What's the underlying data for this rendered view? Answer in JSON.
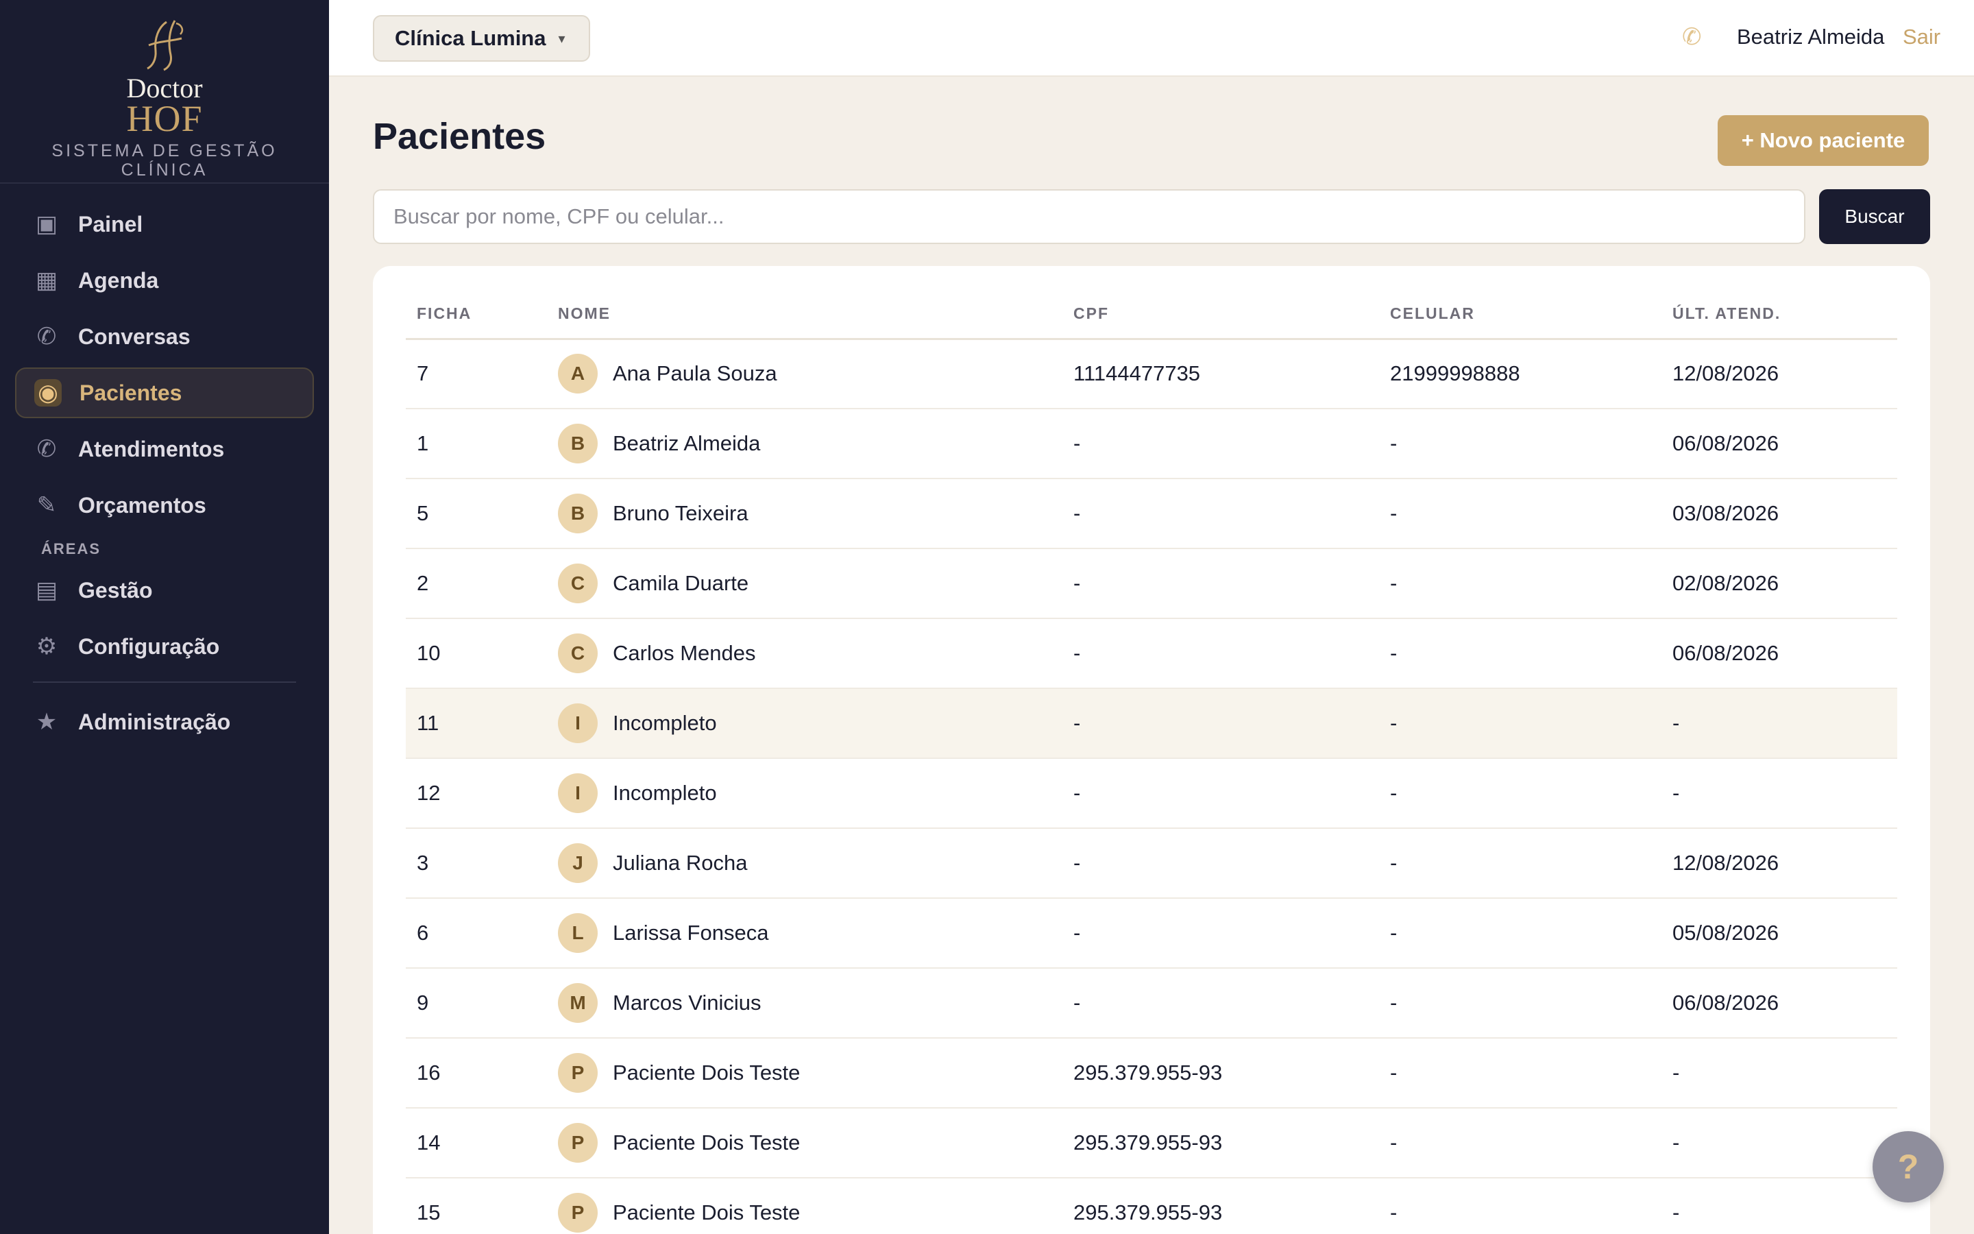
{
  "brand": {
    "line1": "Doctor",
    "line2": "HOF",
    "subtitle": "SISTEMA DE GESTÃO CLÍNICA",
    "accent_color": "#c8a46a"
  },
  "sidebar": {
    "items": [
      {
        "label": "Painel",
        "icon": "dashboard-icon",
        "glyph": "▣"
      },
      {
        "label": "Agenda",
        "icon": "calendar-icon",
        "glyph": "▦"
      },
      {
        "label": "Conversas",
        "icon": "whatsapp-icon",
        "glyph": "✆"
      },
      {
        "label": "Pacientes",
        "icon": "patients-icon",
        "glyph": "◉",
        "active": true
      },
      {
        "label": "Atendimentos",
        "icon": "whatsapp-icon",
        "glyph": "✆"
      },
      {
        "label": "Orçamentos",
        "icon": "pencil-icon",
        "glyph": "✎"
      }
    ],
    "section_label": "ÁREAS",
    "area_items": [
      {
        "label": "Gestão",
        "icon": "list-icon",
        "glyph": "▤"
      },
      {
        "label": "Configuração",
        "icon": "gear-icon",
        "glyph": "⚙"
      }
    ],
    "admin_item": {
      "label": "Administração",
      "icon": "star-icon",
      "glyph": "★"
    }
  },
  "topbar": {
    "clinic": "Clínica Lumina",
    "caret": "▾",
    "phone_glyph": "✆",
    "user": "Beatriz Almeida",
    "logout": "Sair"
  },
  "main": {
    "title": "Pacientes",
    "new_button": "+ Novo paciente",
    "search_placeholder": "Buscar por nome, CPF ou celular...",
    "search_value": "",
    "search_button": "Buscar"
  },
  "table": {
    "columns": [
      "FICHA",
      "NOME",
      "CPF",
      "CELULAR",
      "ÚLT. ATEND."
    ],
    "rows": [
      {
        "ficha": "7",
        "initial": "A",
        "nome": "Ana Paula Souza",
        "cpf": "11144477735",
        "celular": "21999998888",
        "ult": "12/08/2026"
      },
      {
        "ficha": "1",
        "initial": "B",
        "nome": "Beatriz Almeida",
        "cpf": "-",
        "celular": "-",
        "ult": "06/08/2026"
      },
      {
        "ficha": "5",
        "initial": "B",
        "nome": "Bruno Teixeira",
        "cpf": "-",
        "celular": "-",
        "ult": "03/08/2026"
      },
      {
        "ficha": "2",
        "initial": "C",
        "nome": "Camila Duarte",
        "cpf": "-",
        "celular": "-",
        "ult": "02/08/2026"
      },
      {
        "ficha": "10",
        "initial": "C",
        "nome": "Carlos Mendes",
        "cpf": "-",
        "celular": "-",
        "ult": "06/08/2026"
      },
      {
        "ficha": "11",
        "initial": "I",
        "nome": "Incompleto",
        "cpf": "-",
        "celular": "-",
        "ult": "-",
        "highlight": true
      },
      {
        "ficha": "12",
        "initial": "I",
        "nome": "Incompleto",
        "cpf": "-",
        "celular": "-",
        "ult": "-"
      },
      {
        "ficha": "3",
        "initial": "J",
        "nome": "Juliana Rocha",
        "cpf": "-",
        "celular": "-",
        "ult": "12/08/2026"
      },
      {
        "ficha": "6",
        "initial": "L",
        "nome": "Larissa Fonseca",
        "cpf": "-",
        "celular": "-",
        "ult": "05/08/2026"
      },
      {
        "ficha": "9",
        "initial": "M",
        "nome": "Marcos Vinicius",
        "cpf": "-",
        "celular": "-",
        "ult": "06/08/2026"
      },
      {
        "ficha": "16",
        "initial": "P",
        "nome": "Paciente Dois Teste",
        "cpf": "295.379.955-93",
        "celular": "-",
        "ult": "-"
      },
      {
        "ficha": "14",
        "initial": "P",
        "nome": "Paciente Dois Teste",
        "cpf": "295.379.955-93",
        "celular": "-",
        "ult": "-"
      },
      {
        "ficha": "15",
        "initial": "P",
        "nome": "Paciente Dois Teste",
        "cpf": "295.379.955-93",
        "celular": "-",
        "ult": "-"
      }
    ]
  },
  "help_button": "?"
}
